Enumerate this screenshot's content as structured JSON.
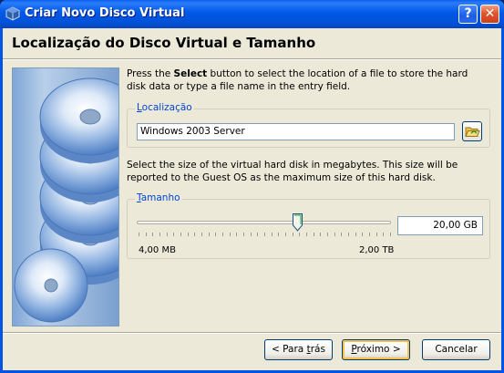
{
  "window": {
    "title": "Criar Novo Disco Virtual",
    "help_label": "?",
    "close_label": "✕"
  },
  "header": {
    "title": "Localização do Disco Virtual e Tamanho"
  },
  "location": {
    "desc_pre": "Press the ",
    "desc_bold": "Select",
    "desc_post": " button to select the location of a file to store the hard disk data or type a file name in the entry field.",
    "label_mnemonic": "L",
    "label_rest": "ocalização",
    "value": "Windows 2003 Server"
  },
  "size": {
    "description": "Select the size of the virtual hard disk in megabytes. This size will be reported to the Guest OS as the maximum size of this hard disk.",
    "label_mnemonic": "T",
    "label_rest": "amanho",
    "value": "20,00 GB",
    "min_label": "4,00 MB",
    "max_label": "2,00 TB",
    "slider_fraction": 0.63
  },
  "buttons": {
    "back_pre": "< Para ",
    "back_mnemonic": "t",
    "back_post": "rás",
    "next_mnemonic": "P",
    "next_post": "róximo >",
    "cancel": "Cancelar"
  },
  "colors": {
    "titlebar": "#0054e3",
    "dialog_bg": "#ece9d8",
    "group_label": "#0046d5"
  },
  "icons": {
    "title": "virtualbox-icon",
    "folder": "folder-open-icon",
    "side": "disk-stack-image"
  }
}
